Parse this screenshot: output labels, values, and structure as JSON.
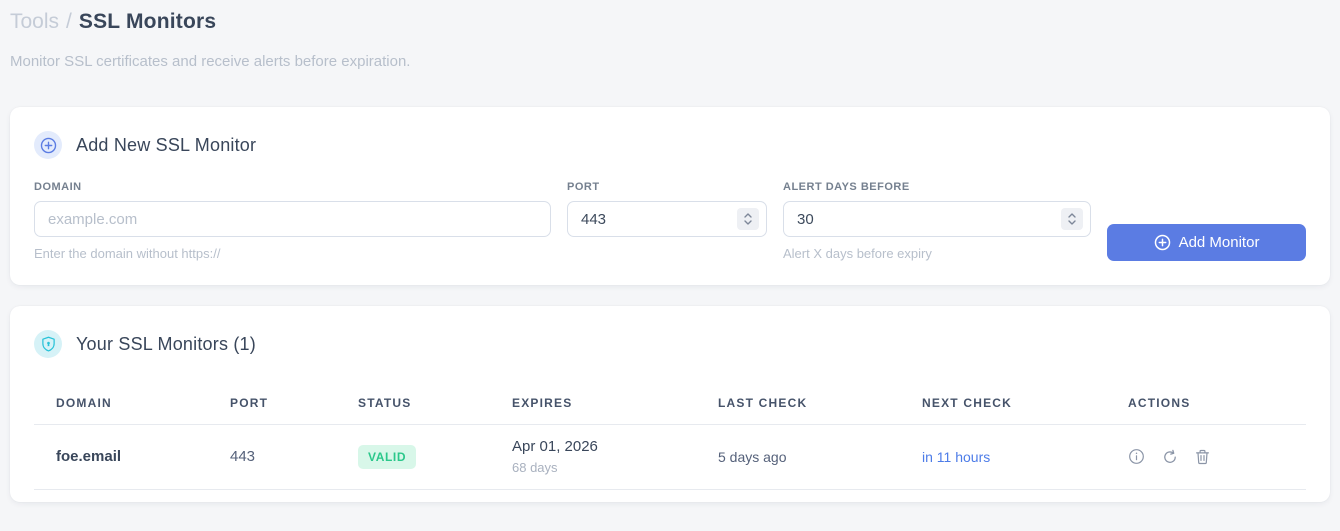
{
  "page": {
    "breadcrumb": {
      "parent": "Tools",
      "separator": "/",
      "current": "SSL Monitors"
    },
    "subtitle": "Monitor SSL certificates and receive alerts before expiration."
  },
  "add_form": {
    "title": "Add New SSL Monitor",
    "fields": {
      "domain": {
        "label": "DOMAIN",
        "placeholder": "example.com",
        "helper": "Enter the domain without https://"
      },
      "port": {
        "label": "PORT",
        "value": "443"
      },
      "alert_days": {
        "label": "ALERT DAYS BEFORE",
        "value": "30",
        "helper": "Alert X days before expiry"
      }
    },
    "submit_label": "Add Monitor"
  },
  "monitors": {
    "title": "Your SSL Monitors (1)",
    "columns": [
      "DOMAIN",
      "PORT",
      "STATUS",
      "EXPIRES",
      "LAST CHECK",
      "NEXT CHECK",
      "ACTIONS"
    ],
    "rows": [
      {
        "domain": "foe.email",
        "port": "443",
        "status": "VALID",
        "expires_date": "Apr 01, 2026",
        "expires_in": "68 days",
        "last_check": "5 days ago",
        "next_check": "in 11 hours"
      }
    ],
    "action_icons": [
      "info",
      "refresh",
      "delete"
    ]
  },
  "colors": {
    "accent_blue": "#5b7ce3",
    "accent_teal": "#27c2d8",
    "success_text": "#2bc88b",
    "success_bg": "#d8f7e9",
    "link_blue": "#4d7ce8",
    "page_bg": "#f5f6f8"
  }
}
